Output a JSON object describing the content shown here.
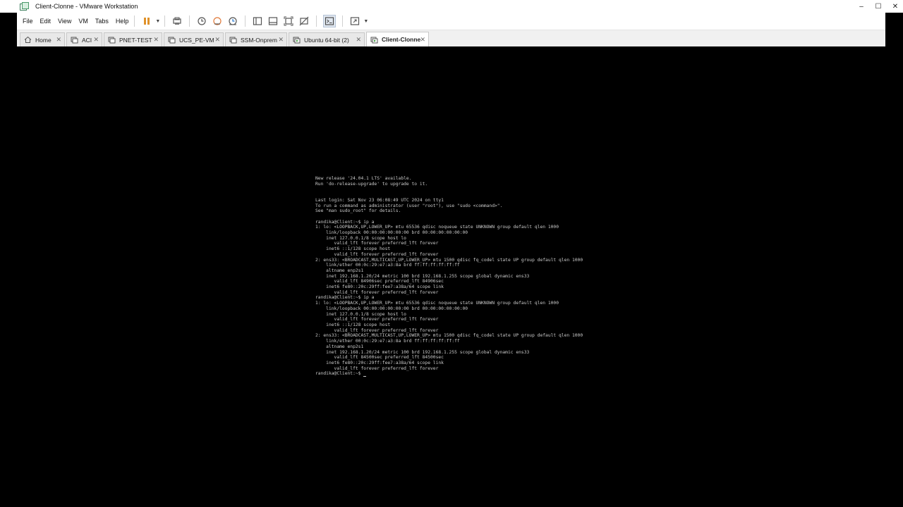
{
  "window": {
    "title": "Client-Clonne - VMware Workstation",
    "controls": {
      "minimize": "–",
      "maximize": "☐",
      "close": "✕"
    }
  },
  "menubar": {
    "items": [
      {
        "label": "File",
        "underline": "F"
      },
      {
        "label": "Edit",
        "underline": "E"
      },
      {
        "label": "View",
        "underline": "V"
      },
      {
        "label": "VM",
        "underline": "M"
      },
      {
        "label": "Tabs",
        "underline": "T"
      },
      {
        "label": "Help",
        "underline": "H"
      }
    ],
    "toolbar_icons": [
      "pause-icon",
      "send-ctrl-alt-del-icon",
      "snapshot-icon",
      "revert-snapshot-icon",
      "snapshot-manager-icon",
      "library-icon",
      "thumbnail-icon",
      "fullscreen-icon",
      "unity-icon",
      "console-view-icon",
      "stretch-icon"
    ]
  },
  "tabs": [
    {
      "label": "Home",
      "icon": "home-icon",
      "active": false
    },
    {
      "label": "ACI",
      "icon": "vm-icon",
      "active": false
    },
    {
      "label": "PNET-TEST",
      "icon": "vm-icon",
      "active": false
    },
    {
      "label": "UCS_PE-VM",
      "icon": "vm-icon",
      "active": false
    },
    {
      "label": "SSM-Onprem",
      "icon": "vm-icon",
      "active": false
    },
    {
      "label": "Ubuntu 64-bit (2)",
      "icon": "vm-running-icon",
      "active": false
    },
    {
      "label": "Client-Clonne",
      "icon": "vm-running-icon",
      "active": true
    }
  ],
  "terminal": {
    "lines": [
      "New release '24.04.1 LTS' available.",
      "Run 'do-release-upgrade' to upgrade to it.",
      "",
      "",
      "Last login: Sat Nov 23 06:08:49 UTC 2024 on tty1",
      "To run a command as administrator (user \"root\"), use \"sudo <command>\".",
      "See \"man sudo_root\" for details.",
      "",
      "randika@Client:~$ ip a",
      "1: lo: <LOOPBACK,UP,LOWER_UP> mtu 65536 qdisc noqueue state UNKNOWN group default qlen 1000",
      "    link/loopback 00:00:00:00:00:00 brd 00:00:00:00:00:00",
      "    inet 127.0.0.1/8 scope host lo",
      "       valid_lft forever preferred_lft forever",
      "    inet6 ::1/128 scope host",
      "       valid_lft forever preferred_lft forever",
      "2: ens33: <BROADCAST,MULTICAST,UP,LOWER_UP> mtu 1500 qdisc fq_codel state UP group default qlen 1000",
      "    link/ether 00:0c:29:e7:a3:8a brd ff:ff:ff:ff:ff:ff",
      "    altname enp2s1",
      "    inet 192.168.1.20/24 metric 100 brd 192.168.1.255 scope global dynamic ens33",
      "       valid_lft 84906sec preferred_lft 84906sec",
      "    inet6 fe80::20c:29ff:fee7:a38a/64 scope link",
      "       valid_lft forever preferred_lft forever",
      "randika@Client:~$ ip a",
      "1: lo: <LOOPBACK,UP,LOWER_UP> mtu 65536 qdisc noqueue state UNKNOWN group default qlen 1000",
      "    link/loopback 00:00:00:00:00:00 brd 00:00:00:00:00:00",
      "    inet 127.0.0.1/8 scope host lo",
      "       valid_lft forever preferred_lft forever",
      "    inet6 ::1/128 scope host",
      "       valid_lft forever preferred_lft forever",
      "2: ens33: <BROADCAST,MULTICAST,UP,LOWER_UP> mtu 1500 qdisc fq_codel state UP group default qlen 1000",
      "    link/ether 00:0c:29:e7:a3:8a brd ff:ff:ff:ff:ff:ff",
      "    altname enp2s1",
      "    inet 192.168.1.20/24 metric 100 brd 192.168.1.255 scope global dynamic ens33",
      "       valid_lft 84500sec preferred_lft 84500sec",
      "    inet6 fe80::20c:29ff:fee7:a38a/64 scope link",
      "       valid_lft forever preferred_lft forever"
    ],
    "prompt": "randika@Client:~$ "
  }
}
